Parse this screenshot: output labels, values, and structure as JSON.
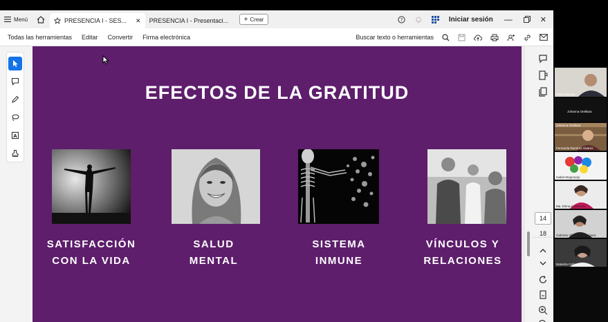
{
  "app": {
    "menu_label": "Menú",
    "tabs": [
      {
        "label": "PRESENCIA I - SES...",
        "active": true
      },
      {
        "label": "PRESENCIA I - Presentaci...",
        "active": false
      }
    ],
    "create_label": "Crear",
    "sign_in": "Iniciar sesión"
  },
  "toolbar": {
    "items": [
      "Todas las herramientas",
      "Editar",
      "Convertir",
      "Firma electrónica"
    ],
    "search_label": "Buscar texto o herramientas"
  },
  "page_nav": {
    "current": "14",
    "total": "18"
  },
  "slide": {
    "title": "EFECTOS DE LA GRATITUD",
    "cards": [
      {
        "line1": "SATISFACCIÓN",
        "line2": "CON LA VIDA"
      },
      {
        "line1": "SALUD",
        "line2": "MENTAL"
      },
      {
        "line1": "SISTEMA",
        "line2": "INMUNE"
      },
      {
        "line1": "VÍNCULOS Y",
        "line2": "RELACIONES"
      }
    ]
  },
  "participants": [
    "Pablo Barriga",
    "Johanna Orellana",
    "Johanna Orellana",
    "Fernanda Ramírez Alvarez",
    "Isabel Mogrovejo",
    "Ma. Elena Aucancela",
    "Gabriela Villamagua Vergara",
    "Natasha Cabrera"
  ],
  "colors": {
    "slide_bg": "#5e1e6c",
    "accent": "#1473e6",
    "window_bg": "#f3f3f3"
  }
}
